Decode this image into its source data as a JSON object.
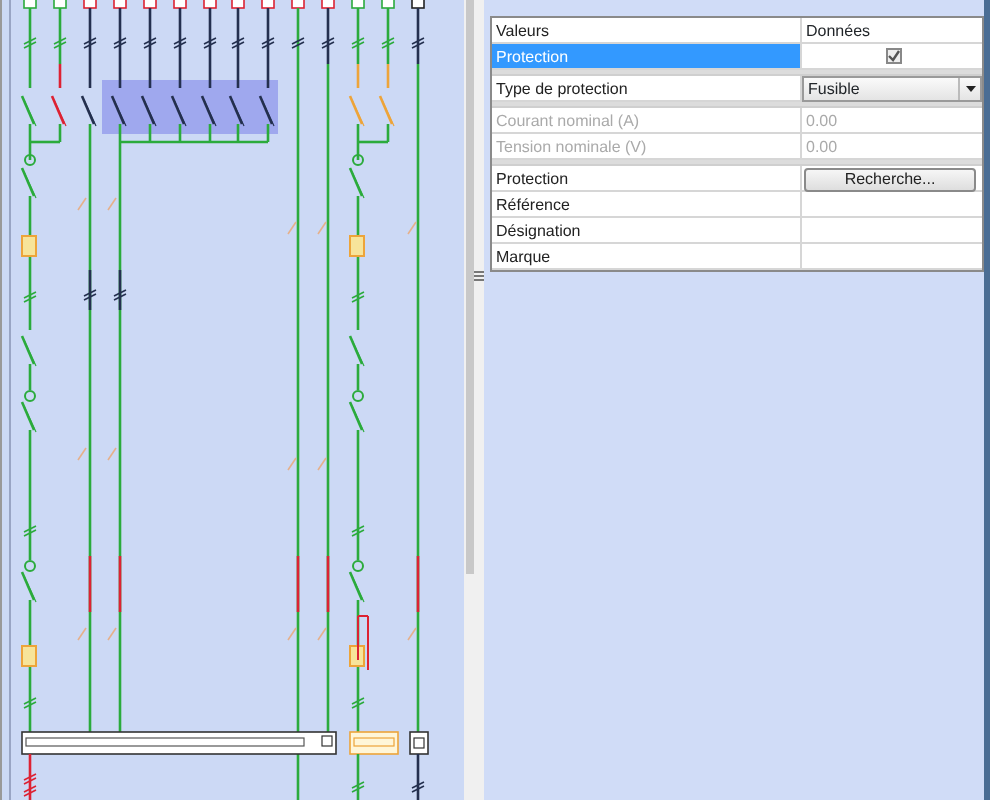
{
  "properties": {
    "columns": [
      "Valeurs",
      "Données"
    ],
    "groups": [
      {
        "rows": [
          {
            "label": "Protection",
            "kind": "checkbox",
            "checked": true,
            "selected": true,
            "disabled": false
          }
        ]
      },
      {
        "rows": [
          {
            "label": "Type de protection",
            "kind": "dropdown",
            "value": "Fusible",
            "selected": false,
            "disabled": false
          }
        ]
      },
      {
        "rows": [
          {
            "label": "Courant nominal (A)",
            "kind": "text",
            "value": "0.00",
            "selected": false,
            "disabled": true
          },
          {
            "label": "Tension nominale (V)",
            "kind": "text",
            "value": "0.00",
            "selected": false,
            "disabled": true
          }
        ]
      },
      {
        "rows": [
          {
            "label": "Protection",
            "kind": "button",
            "value": "Recherche...",
            "selected": false,
            "disabled": false
          },
          {
            "label": "Référence",
            "kind": "text",
            "selected": false,
            "disabled": false
          },
          {
            "label": "Désignation",
            "kind": "text",
            "selected": false,
            "disabled": false
          },
          {
            "label": "Marque",
            "kind": "text",
            "selected": false,
            "disabled": false
          }
        ]
      }
    ]
  }
}
